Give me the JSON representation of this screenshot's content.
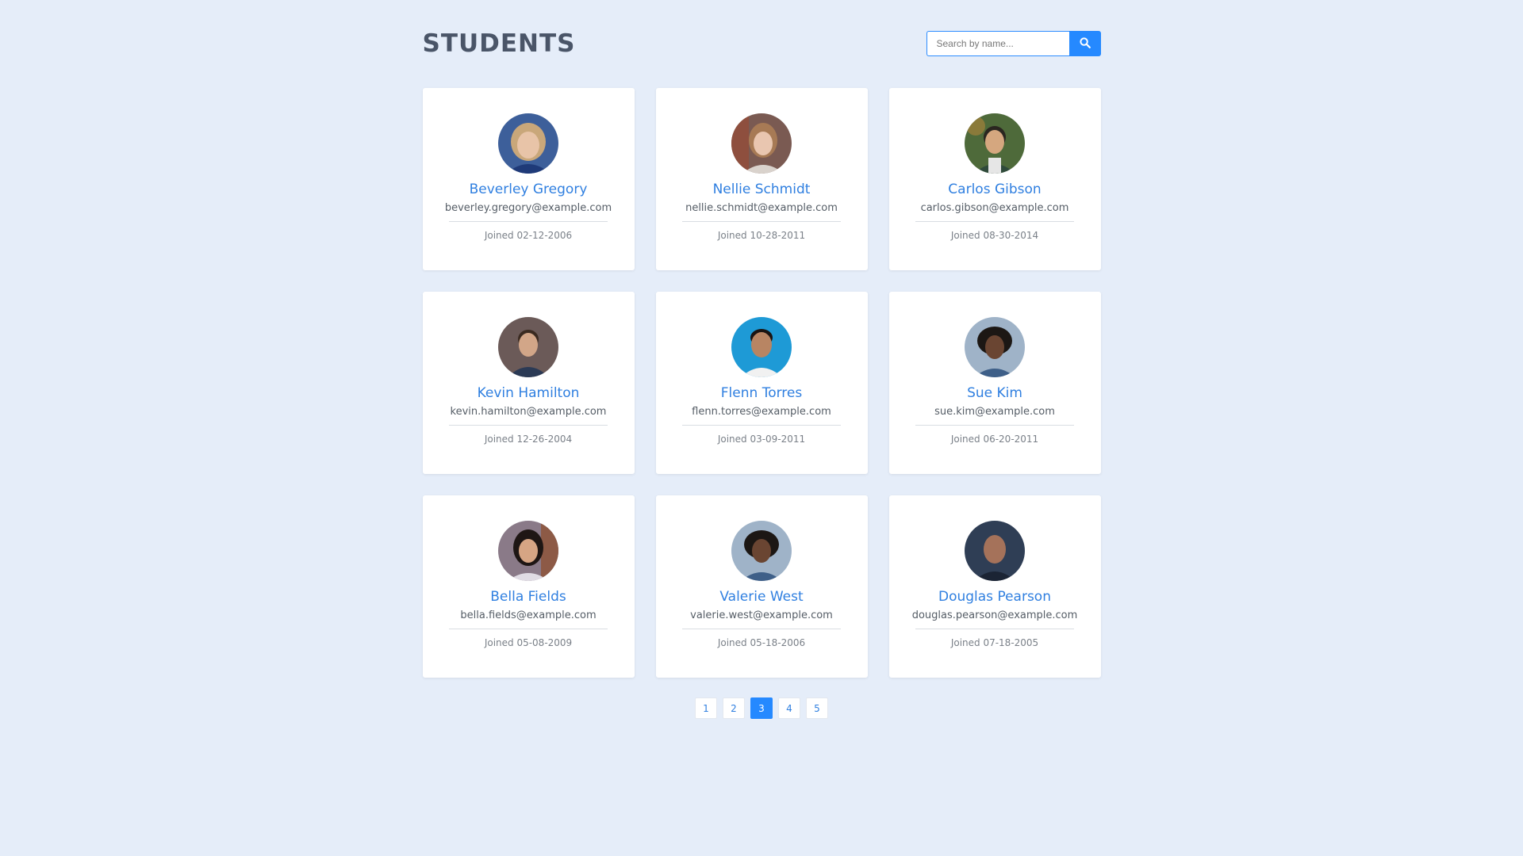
{
  "header": {
    "title": "STUDENTS"
  },
  "search": {
    "placeholder": "Search by name...",
    "value": "",
    "icon": "search-icon"
  },
  "students": [
    {
      "name": "Beverley Gregory",
      "email": "beverley.gregory@example.com",
      "joined": "Joined 02-12-2006"
    },
    {
      "name": "Nellie Schmidt",
      "email": "nellie.schmidt@example.com",
      "joined": "Joined 10-28-2011"
    },
    {
      "name": "Carlos Gibson",
      "email": "carlos.gibson@example.com",
      "joined": "Joined 08-30-2014"
    },
    {
      "name": "Kevin Hamilton",
      "email": "kevin.hamilton@example.com",
      "joined": "Joined 12-26-2004"
    },
    {
      "name": "Flenn Torres",
      "email": "flenn.torres@example.com",
      "joined": "Joined 03-09-2011"
    },
    {
      "name": "Sue Kim",
      "email": "sue.kim@example.com",
      "joined": "Joined 06-20-2011"
    },
    {
      "name": "Bella Fields",
      "email": "bella.fields@example.com",
      "joined": "Joined 05-08-2009"
    },
    {
      "name": "Valerie West",
      "email": "valerie.west@example.com",
      "joined": "Joined 05-18-2006"
    },
    {
      "name": "Douglas Pearson",
      "email": "douglas.pearson@example.com",
      "joined": "Joined 07-18-2005"
    }
  ],
  "pagination": {
    "pages": [
      "1",
      "2",
      "3",
      "4",
      "5"
    ],
    "current": "3"
  },
  "colors": {
    "background": "#e5edf9",
    "accent": "#2589ff",
    "name_text": "#2f7fe0",
    "title_text": "#4a5568"
  }
}
